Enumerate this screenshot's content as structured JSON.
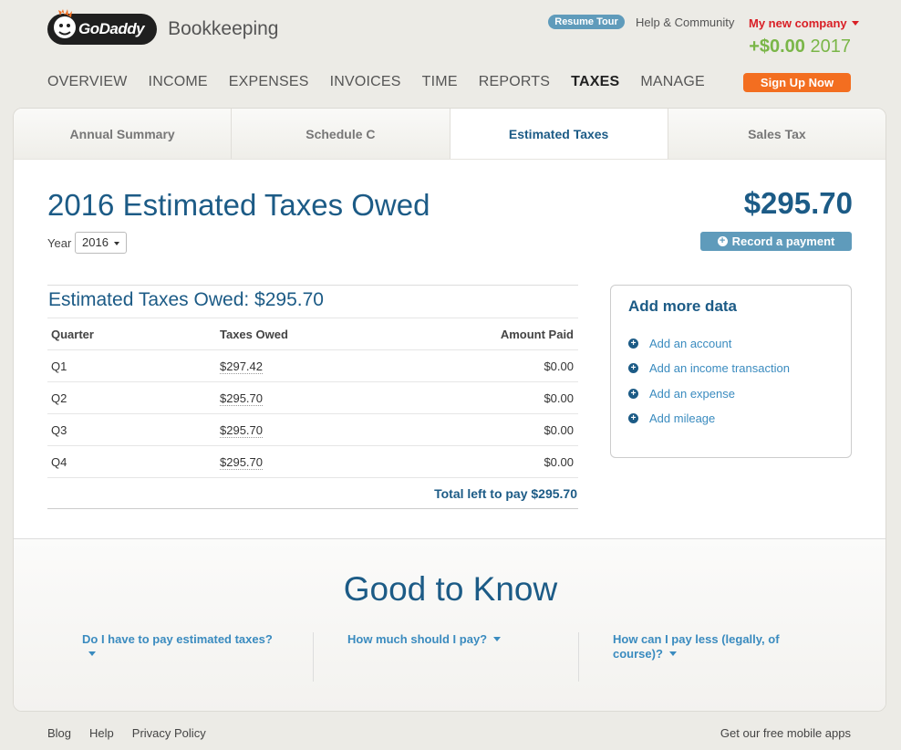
{
  "header": {
    "brand": "GoDaddy",
    "product": "Bookkeeping",
    "resume_tour": "Resume Tour",
    "help_link": "Help & Community",
    "company": "My new company",
    "balance_amount": "+$0.00",
    "balance_year": "2017",
    "signup": "Sign Up Now"
  },
  "nav": {
    "items": [
      {
        "label": "OVERVIEW"
      },
      {
        "label": "INCOME"
      },
      {
        "label": "EXPENSES"
      },
      {
        "label": "INVOICES"
      },
      {
        "label": "TIME"
      },
      {
        "label": "REPORTS"
      },
      {
        "label": "TAXES"
      },
      {
        "label": "MANAGE"
      }
    ],
    "active": "TAXES"
  },
  "tabs": [
    {
      "label": "Annual Summary"
    },
    {
      "label": "Schedule C"
    },
    {
      "label": "Estimated Taxes"
    },
    {
      "label": "Sales Tax"
    }
  ],
  "main": {
    "title": "2016 Estimated Taxes Owed",
    "total": "$295.70",
    "year_label": "Year",
    "year_value": "2016",
    "record_payment": "Record a payment"
  },
  "table": {
    "title": "Estimated Taxes Owed: $295.70",
    "headers": [
      "Quarter",
      "Taxes Owed",
      "Amount Paid"
    ],
    "rows": [
      {
        "quarter": "Q1",
        "owed": "$297.42",
        "paid": "$0.00"
      },
      {
        "quarter": "Q2",
        "owed": "$295.70",
        "paid": "$0.00"
      },
      {
        "quarter": "Q3",
        "owed": "$295.70",
        "paid": "$0.00"
      },
      {
        "quarter": "Q4",
        "owed": "$295.70",
        "paid": "$0.00"
      }
    ],
    "total_text": "Total left to pay $295.70"
  },
  "sidebox": {
    "title": "Add more data",
    "links": [
      {
        "label": "Add an account"
      },
      {
        "label": "Add an income transaction"
      },
      {
        "label": "Add an expense"
      },
      {
        "label": "Add mileage"
      }
    ]
  },
  "good_to_know": {
    "title": "Good to Know",
    "faqs": [
      {
        "label": "Do I have to pay estimated taxes?"
      },
      {
        "label": "How much should I pay?"
      },
      {
        "label": "How can I pay less (legally, of course)?"
      }
    ]
  },
  "footer": {
    "links": [
      {
        "label": "Blog"
      },
      {
        "label": "Help"
      },
      {
        "label": "Privacy Policy"
      }
    ],
    "mobile": "Get our free mobile apps"
  },
  "colors": {
    "brand_blue": "#1c5b86",
    "link_blue": "#3a8bbf",
    "accent_orange": "#f36e20",
    "company_red": "#d91f26",
    "balance_green": "#7ab648",
    "button_blue": "#5f9bbb"
  }
}
